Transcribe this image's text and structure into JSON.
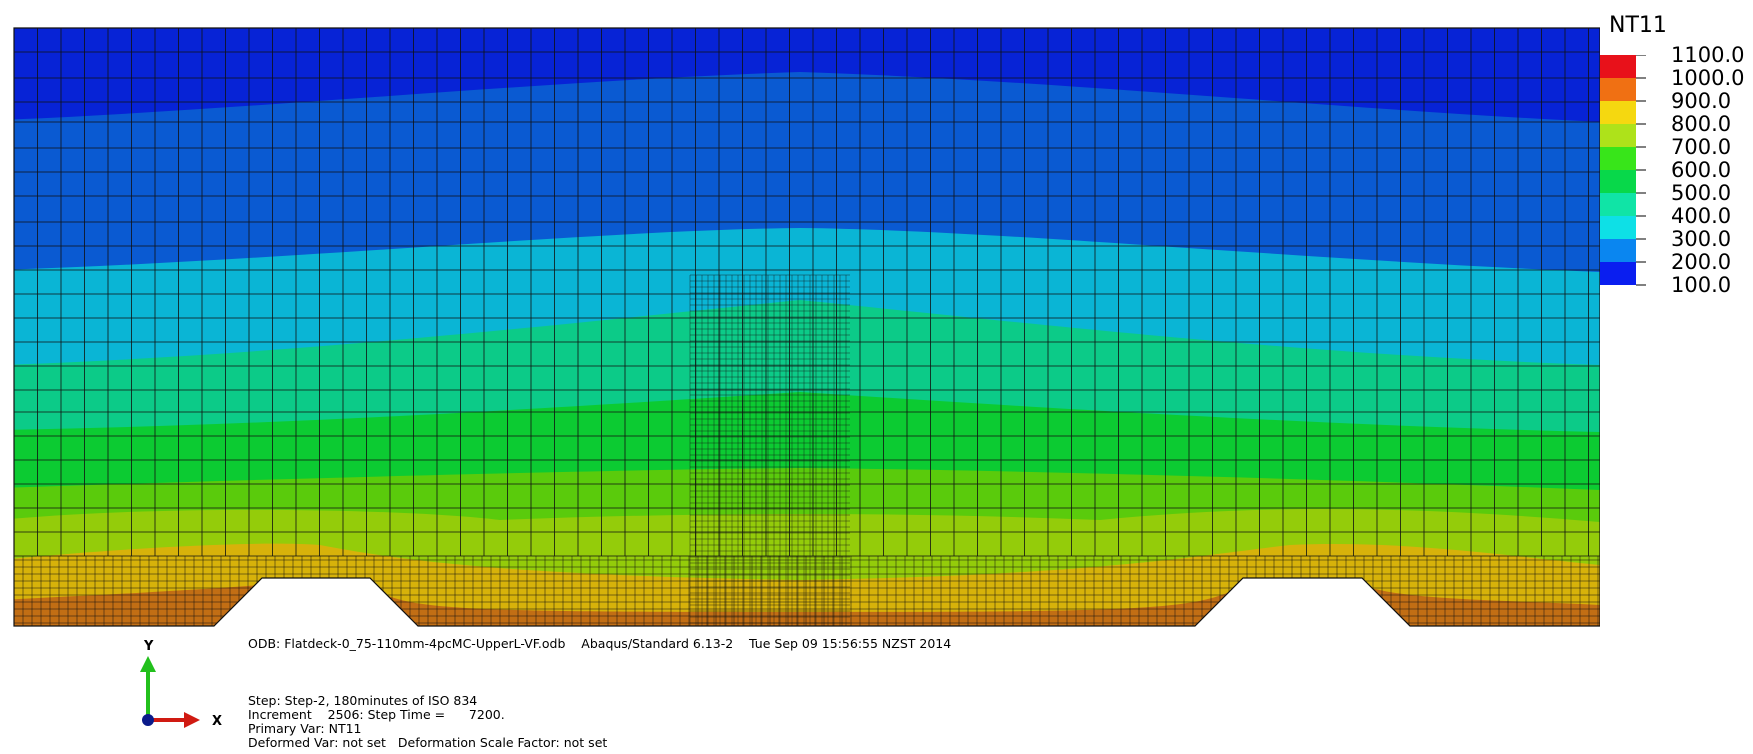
{
  "legend": {
    "title": "NT11",
    "labels": [
      "1100.0",
      "1000.0",
      "900.0",
      "800.0",
      "700.0",
      "600.0",
      "500.0",
      "400.0",
      "300.0",
      "200.0",
      "100.0"
    ],
    "band_colors": [
      "#e8111a",
      "#f07013",
      "#f5d810",
      "#aee21a",
      "#38e51a",
      "#08d84a",
      "#10e4a6",
      "#0ee0e6",
      "#0a86f0",
      "#0a1ef0"
    ]
  },
  "contour_colors": {
    "band_100_150": "#0723d6",
    "band_150_250": "#0a5ad2",
    "band_250_350": "#0ab5d5",
    "band_350_450": "#0ccb88",
    "band_450_550": "#0ccb32",
    "band_550_650": "#5acb0c",
    "band_650_750": "#94cc0a",
    "band_750_850": "#d7b20a",
    "band_850_950": "#c26e14",
    "mesh_lines": "#111111"
  },
  "info": {
    "odb_line": "ODB: Flatdeck-0_75-110mm-4pcMC-UpperL-VF.odb    Abaqus/Standard 6.13-2    Tue Sep 09 15:56:55 NZST 2014",
    "step_line": "Step: Step-2, 180minutes of ISO 834",
    "increment_line": "Increment    2506: Step Time =      7200.",
    "primary_var_line": "Primary Var: NT11",
    "deformed_var_line": "Deformed Var: not set   Deformation Scale Factor: not set"
  },
  "triad": {
    "y_label": "Y",
    "x_label": "X",
    "y_color": "#22c01c",
    "x_color": "#d01a12",
    "origin_color": "#0a1a8a"
  }
}
